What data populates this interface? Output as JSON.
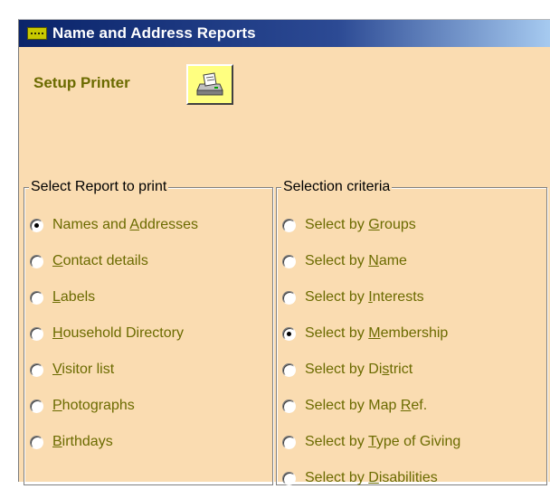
{
  "window": {
    "title": "Name and Address Reports"
  },
  "setup_printer": {
    "label": "Setup Printer",
    "icon": "printer-icon"
  },
  "report_group": {
    "legend": "Select Report to print",
    "options": [
      {
        "pre": "Names and ",
        "key": "A",
        "post": "ddresses",
        "checked": true
      },
      {
        "pre": "",
        "key": "C",
        "post": "ontact details",
        "checked": false
      },
      {
        "pre": "",
        "key": "L",
        "post": "abels",
        "checked": false
      },
      {
        "pre": "",
        "key": "H",
        "post": "ousehold Directory",
        "checked": false
      },
      {
        "pre": "",
        "key": "V",
        "post": "isitor list",
        "checked": false
      },
      {
        "pre": "",
        "key": "P",
        "post": "hotographs",
        "checked": false
      },
      {
        "pre": "",
        "key": "B",
        "post": "irthdays",
        "checked": false
      }
    ]
  },
  "criteria_group": {
    "legend": "Selection criteria",
    "options": [
      {
        "pre": "Select by ",
        "key": "G",
        "post": "roups",
        "checked": false
      },
      {
        "pre": "Select by ",
        "key": "N",
        "post": "ame",
        "checked": false
      },
      {
        "pre": "Select by ",
        "key": "I",
        "post": "nterests",
        "checked": false
      },
      {
        "pre": "Select by ",
        "key": "M",
        "post": "embership",
        "checked": true
      },
      {
        "pre": "Select by Di",
        "key": "s",
        "post": "trict",
        "checked": false
      },
      {
        "pre": "Select by Map ",
        "key": "R",
        "post": "ef.",
        "checked": false
      },
      {
        "pre": "Select by ",
        "key": "T",
        "post": "ype of Giving",
        "checked": false
      },
      {
        "pre": "Select by ",
        "key": "D",
        "post": "isabilities",
        "checked": false
      }
    ]
  }
}
